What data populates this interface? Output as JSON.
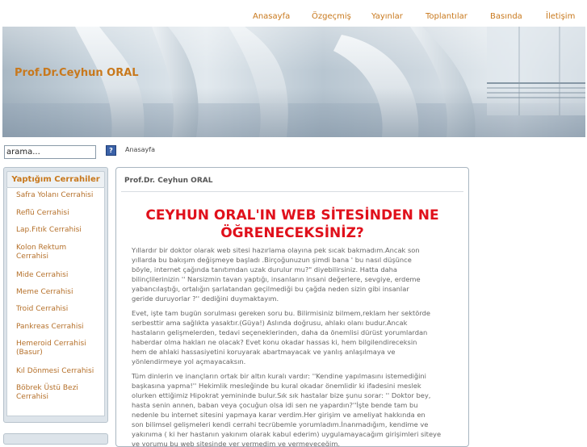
{
  "nav": {
    "items": [
      "Anasayfa",
      "Özgeçmiş",
      "Yayınlar",
      "Toplantılar",
      "Basında",
      "İletişim"
    ]
  },
  "header": {
    "site_title": "Prof.Dr.Ceyhun ORAL"
  },
  "search": {
    "value": "arama...",
    "button_label": "?"
  },
  "breadcrumb": "Anasayfa",
  "sidebar": {
    "heading": "Yaptığım Cerrahiler",
    "items": [
      [
        "Safra Yolanı Cerrahisi"
      ],
      [
        "Reflü Cerrahisi"
      ],
      [
        "Lap.Fıtık Cerrahisi"
      ],
      [
        "Kolon Rektum",
        "Cerrahisi"
      ],
      [
        "Mide Cerrahisi"
      ],
      [
        "Meme Cerrahisi"
      ],
      [
        "Troid Cerrahisi"
      ],
      [
        "Pankreas Cerrahisi"
      ],
      [
        "Hemeroid Cerrahisi",
        "(Basur)"
      ],
      [
        "Kıl Dönmesi Cerrahisi"
      ],
      [
        "Böbrek Üstü Bezi",
        "Cerrahisi"
      ]
    ]
  },
  "main": {
    "page_heading": "Prof.Dr. Ceyhun ORAL",
    "title_lines": [
      "CEYHUN ORAL'IN WEB SİTESİNDEN NE",
      "ÖĞRENECEKSİNİZ?"
    ],
    "paragraphs": [
      [
        "Yıllardır bir doktor olarak web sitesi hazırlama olayına pek sıcak bakmadım.Ancak son",
        "yıllarda bu bakışım değişmeye başladı .Birçoğunuzun şimdi bana ' bu nasıl düşünce",
        "böyle, internet çağında tanıtımdan uzak durulur mu?\" diyebilirsiniz. Hatta daha",
        "bilinçlilerinizin '' Narsizmin tavan yaptığı, insanların insani değerlere, sevgiye, erdeme",
        "yabancılaştığı, ortalığın şarlatandan geçilmediği bu çağda neden sizin gibi insanlar",
        "geride duruyorlar ?'' dediğini duymaktayım."
      ],
      [
        "Evet, işte tam bugün sorulması gereken soru bu. Bilirmisiniz bilmem,reklam her sektörde",
        "serbesttir ama sağlıkta yasaktır.(Güya!) Aslında doğrusu, ahlakı olanı budur.Ancak",
        "hastaların gelişmelerden, tedavi seçeneklerinden, daha da önemlisi dürüst yorumlardan",
        "haberdar olma hakları ne olacak? Evet konu okadar hassas ki, hem bilgilendireceksin",
        "hem de ahlaki hassasiyetini koruyarak abartmayacak ve yanlış anlaşılmaya ve",
        "yönlendirmeye yol açmayacaksın."
      ],
      [
        "Tüm dinlerin ve inançların ortak bir altın kuralı vardır: ''Kendine yapılmasını istemediğini",
        "başkasına yapma!'' Hekimlik mesleğinde bu kural okadar önemlidir ki ifadesini meslek",
        "olurken ettiğimiz Hipokrat yemininde bulur.Sık sık hastalar bize şunu sorar: '' Doktor bey,",
        "hasta senin annen, baban veya çocuğun olsa idi sen ne yapardın?''İşte bende tam bu",
        "nedenle bu internet sitesini yapmaya karar verdim.Her girişim ve ameliyat hakkında en",
        "son bilimsel gelişmeleri kendi cerrahi tecrübemle yorumladım.İnanmadığım, kendime ve",
        "yakınıma ( ki her hastanın yakınım olarak kabul ederim) uygulamayacağım girişimleri siteye",
        "ve yorumu bu web sitesinde yer vermedim ve vermeyeceğim."
      ]
    ]
  },
  "colors": {
    "accent": "#c8781c",
    "title_red": "#e0101b",
    "panel_bg": "#dde4ea"
  }
}
